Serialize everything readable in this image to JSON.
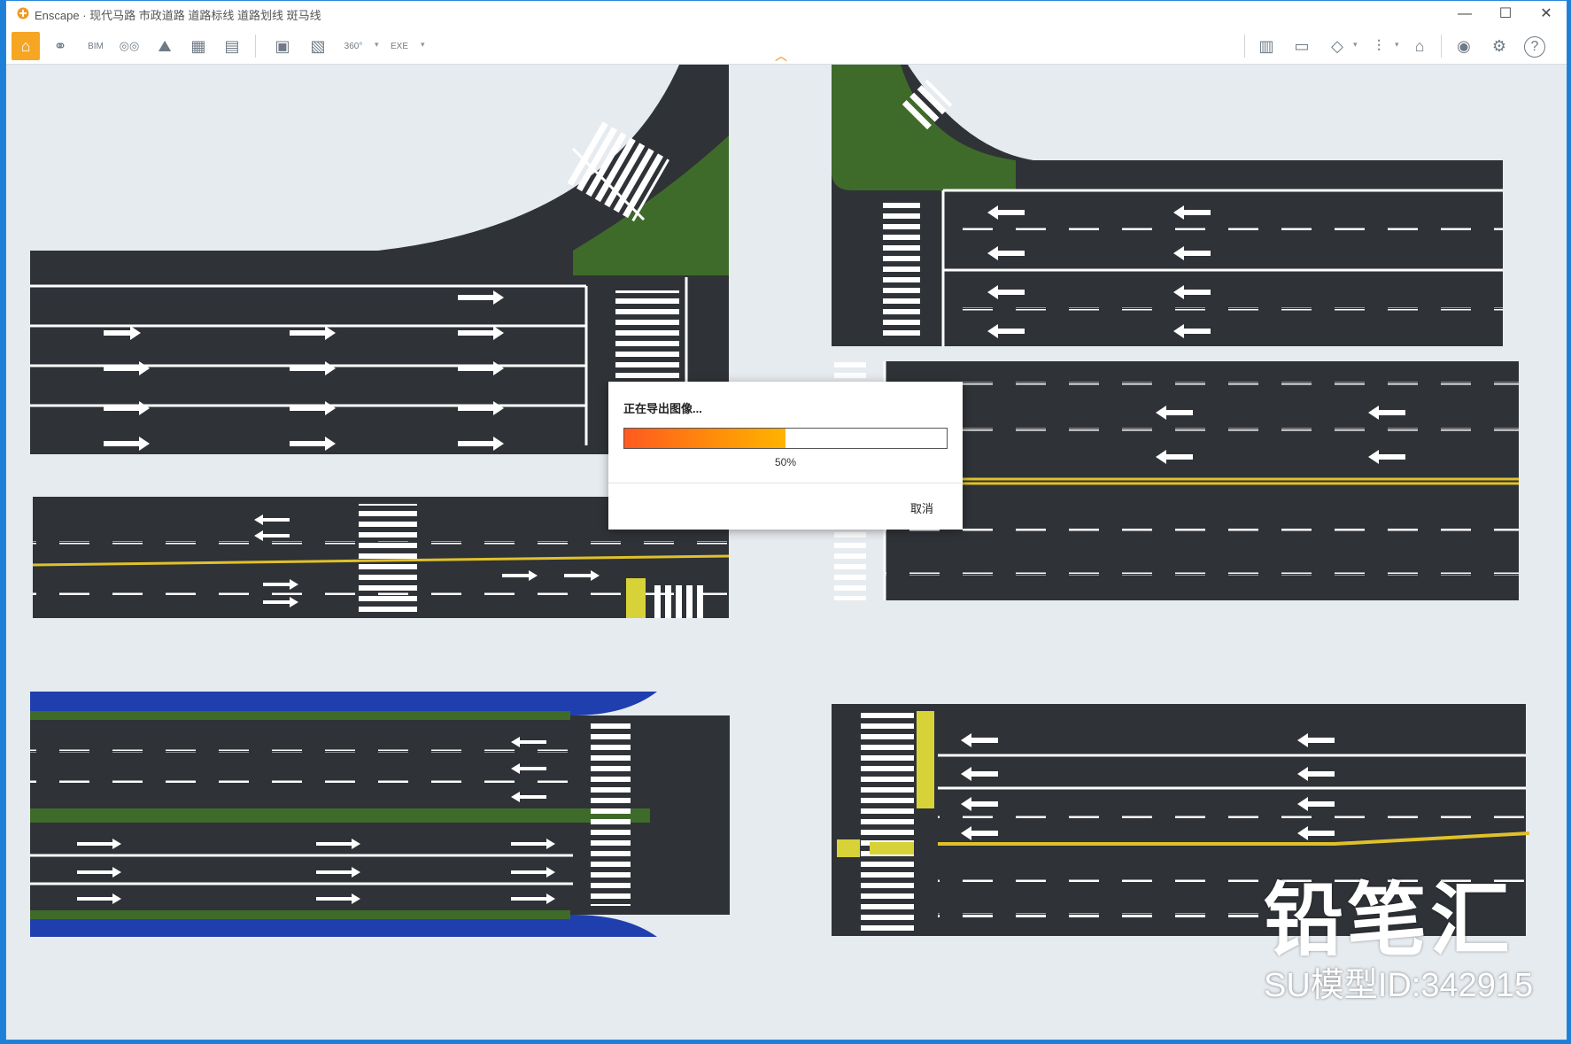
{
  "window": {
    "title": "Enscape · 现代马路 市政道路 道路标线 道路划线 斑马线",
    "minimize": "—",
    "maximize": "☐",
    "close": "✕"
  },
  "toolbar": {
    "items": [
      {
        "name": "home-icon",
        "label": "⌂"
      },
      {
        "name": "link-icon",
        "label": "⚭"
      },
      {
        "name": "bim-icon",
        "label": "BIM"
      },
      {
        "name": "binoculars-icon",
        "label": "◎◎"
      },
      {
        "name": "navigation-icon",
        "label": "⛰"
      },
      {
        "name": "buildings-icon",
        "label": "▦"
      },
      {
        "name": "asset-library-icon",
        "label": "▤"
      },
      {
        "name": "screenshot-icon",
        "label": "▣"
      },
      {
        "name": "batch-render-icon",
        "label": "▧"
      },
      {
        "name": "panorama-360-icon",
        "label": "360°"
      },
      {
        "name": "export-exe-icon",
        "label": "EXE"
      },
      {
        "name": "map-icon",
        "label": "▥"
      },
      {
        "name": "video-editor-icon",
        "label": "▭"
      },
      {
        "name": "cube-icon",
        "label": "◇"
      },
      {
        "name": "material-icon",
        "label": "⫶"
      },
      {
        "name": "vr-headset-icon",
        "label": "⌂"
      },
      {
        "name": "visual-settings-icon",
        "label": "◉"
      },
      {
        "name": "settings-gear-icon",
        "label": "⚙"
      },
      {
        "name": "help-icon",
        "label": "?"
      }
    ]
  },
  "dialog": {
    "title": "正在导出图像...",
    "progress": 0.5,
    "progress_label": "50%",
    "cancel": "取消"
  },
  "watermark": {
    "brand": "铅笔汇",
    "model_id": "SU模型ID:342915"
  },
  "colors": {
    "asphalt": "#2f3237",
    "grass": "#3f6b2a",
    "bike_lane_blue": "#1f3fae",
    "yellow_line": "#e0c12a",
    "accent": "#f6a623"
  }
}
